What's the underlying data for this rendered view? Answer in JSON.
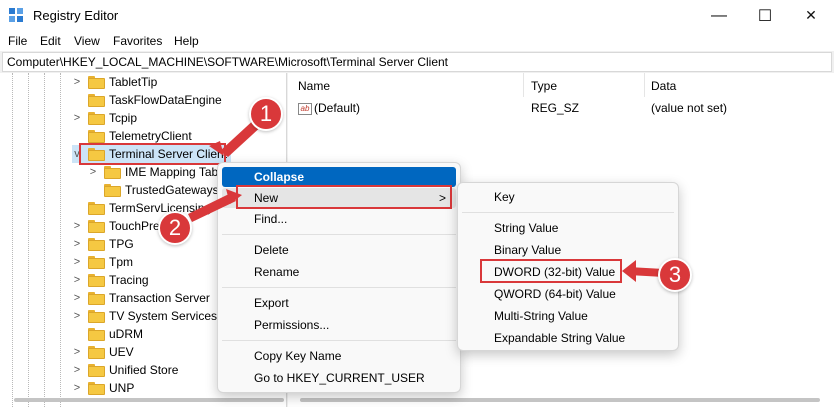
{
  "window": {
    "title": "Registry Editor",
    "minimize": "—",
    "maximize": "☐",
    "close": "✕"
  },
  "menu": [
    "File",
    "Edit",
    "View",
    "Favorites",
    "Help"
  ],
  "address": "Computer\\HKEY_LOCAL_MACHINE\\SOFTWARE\\Microsoft\\Terminal Server Client",
  "tree": {
    "items": [
      {
        "label": "TabletTip",
        "expander": ">"
      },
      {
        "label": "TaskFlowDataEngine",
        "expander": ""
      },
      {
        "label": "Tcpip",
        "expander": ">"
      },
      {
        "label": "TelemetryClient",
        "expander": ""
      },
      {
        "label": "Terminal Server Client",
        "expander": "v"
      },
      {
        "label": "IME Mapping Tab",
        "expander": ">"
      },
      {
        "label": "TrustedGateways",
        "expander": ""
      },
      {
        "label": "TermServLicensing",
        "expander": ""
      },
      {
        "label": "TouchPre",
        "expander": ">"
      },
      {
        "label": "TPG",
        "expander": ">"
      },
      {
        "label": "Tpm",
        "expander": ">"
      },
      {
        "label": "Tracing",
        "expander": ">"
      },
      {
        "label": "Transaction Server",
        "expander": ">"
      },
      {
        "label": "TV System Services",
        "expander": ">"
      },
      {
        "label": "uDRM",
        "expander": ""
      },
      {
        "label": "UEV",
        "expander": ">"
      },
      {
        "label": "Unified Store",
        "expander": ">"
      },
      {
        "label": "UNP",
        "expander": ">"
      }
    ]
  },
  "list": {
    "columns": [
      "Name",
      "Type",
      "Data"
    ],
    "rows": [
      {
        "icon": "ab",
        "name": "(Default)",
        "type": "REG_SZ",
        "data": "(value not set)"
      }
    ]
  },
  "context_menu": {
    "items": [
      "Collapse",
      "New",
      "Find...",
      "Delete",
      "Rename",
      "Export",
      "Permissions...",
      "Copy Key Name",
      "Go to HKEY_CURRENT_USER"
    ],
    "new_arrow": ">"
  },
  "submenu": {
    "items": [
      "Key",
      "String Value",
      "Binary Value",
      "DWORD (32-bit) Value",
      "QWORD (64-bit) Value",
      "Multi-String Value",
      "Expandable String Value"
    ]
  },
  "annotations": {
    "step1": "1",
    "step2": "2",
    "step3": "3",
    "accent": "#d9383a"
  }
}
